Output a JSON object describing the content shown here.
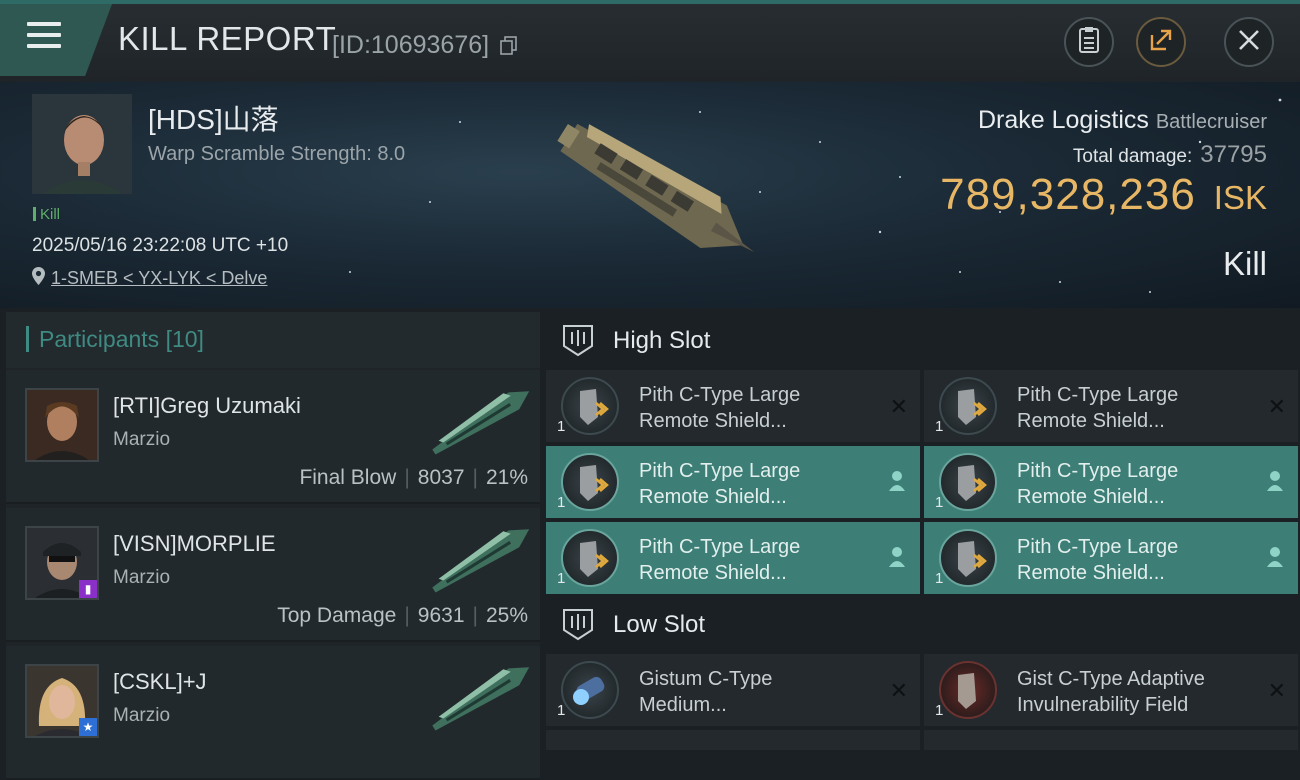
{
  "header": {
    "title": "KILL REPORT",
    "report_id": "[ID:10693676]"
  },
  "victim": {
    "pilot": "[HDS]山落",
    "warp_scramble": "Warp Scramble Strength: 8.0",
    "tag": "Kill",
    "datetime": "2025/05/16 23:22:08 UTC +10",
    "location": "1-SMEB < YX-LYK < Delve",
    "ship_name": "Drake Logistics",
    "ship_class": "Battlecruiser",
    "total_damage_label": "Total damage:",
    "total_damage": "37795",
    "isk_value": "789,328,236",
    "isk_unit": "ISK",
    "result": "Kill"
  },
  "participants": {
    "title": "Participants",
    "count": "[10]",
    "rows": [
      {
        "name": "[RTI]Greg Uzumaki",
        "corp": "Marzio",
        "role": "Final Blow",
        "damage": "8037",
        "percent": "21%"
      },
      {
        "name": "[VISN]MORPLIE",
        "corp": "Marzio",
        "role": "Top Damage",
        "damage": "9631",
        "percent": "25%"
      },
      {
        "name": "[CSKL]+J",
        "corp": "Marzio",
        "role": "",
        "damage": "",
        "percent": ""
      }
    ]
  },
  "slots": {
    "high": {
      "title": "High Slot",
      "modules": [
        {
          "line1": "Pith C-Type Large",
          "line2": "Remote Shield...",
          "qty": "1",
          "state": "destroyed"
        },
        {
          "line1": "Pith C-Type Large",
          "line2": "Remote Shield...",
          "qty": "1",
          "state": "destroyed"
        },
        {
          "line1": "Pith C-Type Large",
          "line2": "Remote Shield...",
          "qty": "1",
          "state": "dropped"
        },
        {
          "line1": "Pith C-Type Large",
          "line2": "Remote Shield...",
          "qty": "1",
          "state": "dropped"
        },
        {
          "line1": "Pith C-Type Large",
          "line2": "Remote Shield...",
          "qty": "1",
          "state": "dropped"
        },
        {
          "line1": "Pith C-Type Large",
          "line2": "Remote Shield...",
          "qty": "1",
          "state": "dropped"
        }
      ]
    },
    "low": {
      "title": "Low Slot",
      "modules": [
        {
          "line1": "Gistum C-Type",
          "line2": "Medium...",
          "qty": "1",
          "state": "destroyed"
        },
        {
          "line1": "Gist C-Type Adaptive",
          "line2": "Invulnerability Field",
          "qty": "1",
          "state": "destroyed"
        }
      ]
    }
  },
  "colors": {
    "accent_teal": "#3f8a83",
    "dropped_row": "#3d7f77",
    "isk_gold": "#e8b765"
  }
}
